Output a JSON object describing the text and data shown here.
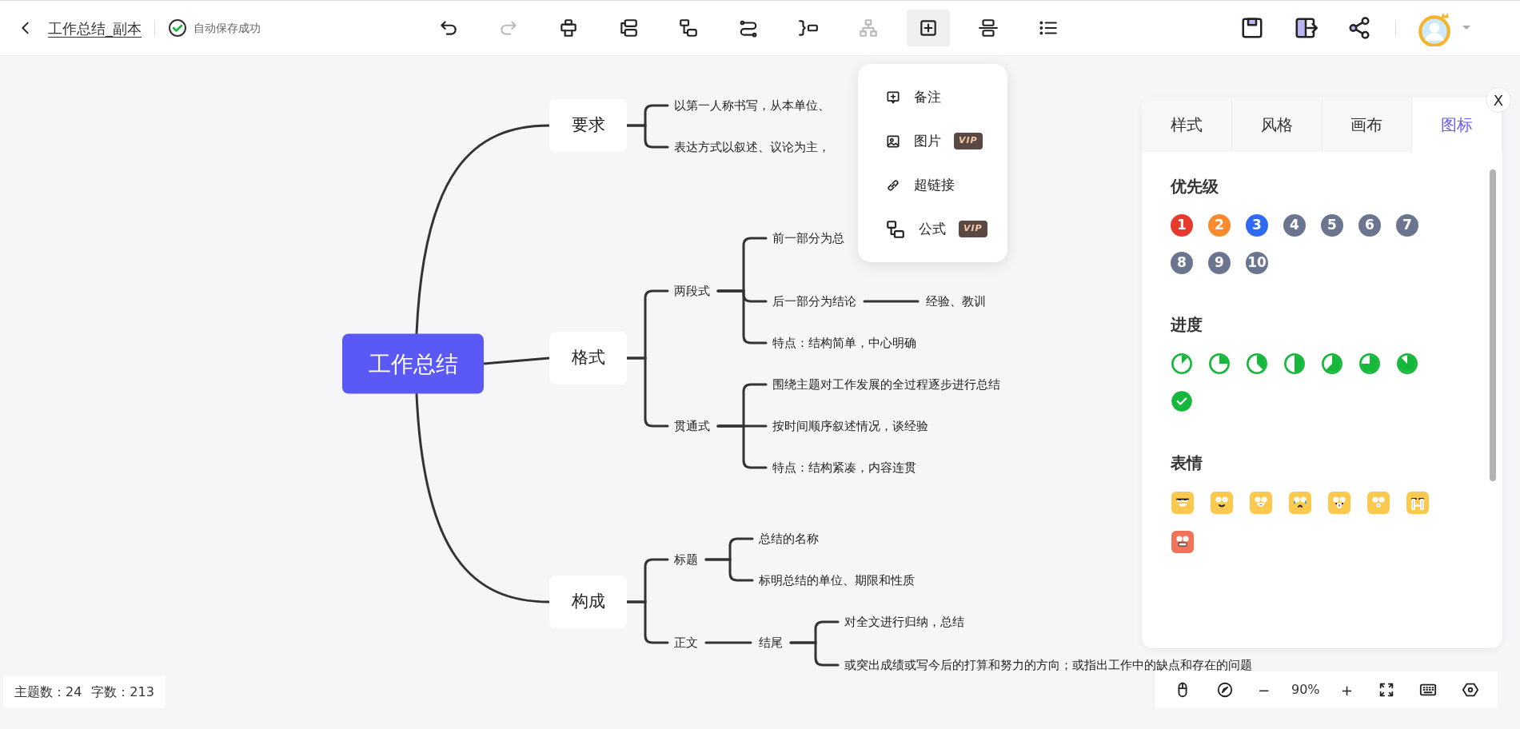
{
  "header": {
    "title": "工作总结_副本",
    "save_status": "自动保存成功"
  },
  "toolbar": [
    {
      "kind": "undo",
      "disabled": false,
      "selected": false
    },
    {
      "kind": "redo",
      "disabled": true,
      "selected": false
    },
    {
      "kind": "parent",
      "disabled": false,
      "selected": false
    },
    {
      "kind": "sibling",
      "disabled": false,
      "selected": false
    },
    {
      "kind": "child",
      "disabled": false,
      "selected": false
    },
    {
      "kind": "relation",
      "disabled": false,
      "selected": false
    },
    {
      "kind": "summary",
      "disabled": false,
      "selected": false
    },
    {
      "kind": "structure",
      "disabled": true,
      "selected": false
    },
    {
      "kind": "insert",
      "disabled": false,
      "selected": true
    },
    {
      "kind": "align",
      "disabled": false,
      "selected": false
    },
    {
      "kind": "outline",
      "disabled": false,
      "selected": false
    }
  ],
  "actions": [
    {
      "kind": "save"
    },
    {
      "kind": "export"
    },
    {
      "kind": "share"
    }
  ],
  "insert_menu": [
    {
      "kind": "note",
      "label": "备注"
    },
    {
      "kind": "image",
      "label": "图片",
      "badge": "VIP"
    },
    {
      "kind": "link",
      "label": "超链接"
    },
    {
      "kind": "formula",
      "label": "公式",
      "badge": "VIP"
    }
  ],
  "mind_map": {
    "root": {
      "label": "工作总结",
      "children": [
        {
          "label": "要求",
          "children": [
            {
              "label": "以第一人称书写，从本单位、"
            },
            {
              "label": "表达方式以叙述、议论为主，"
            }
          ]
        },
        {
          "label": "格式",
          "children": [
            {
              "label": "两段式",
              "children": [
                {
                  "label": "前一部分为总"
                },
                {
                  "label": "后一部分为结论",
                  "children": [
                    {
                      "label": "经验、教训"
                    }
                  ]
                },
                {
                  "label": "特点：结构简单，中心明确"
                }
              ]
            },
            {
              "label": "贯通式",
              "children": [
                {
                  "label": "围绕主题对工作发展的全过程逐步进行总结"
                },
                {
                  "label": "按时间顺序叙述情况，谈经验"
                },
                {
                  "label": "特点：结构紧凑，内容连贯"
                }
              ]
            }
          ]
        },
        {
          "label": "构成",
          "children": [
            {
              "label": "标题",
              "children": [
                {
                  "label": "总结的名称"
                },
                {
                  "label": "标明总结的单位、期限和性质"
                }
              ]
            },
            {
              "label": "正文",
              "children": [
                {
                  "label": "结尾",
                  "children": [
                    {
                      "label": "对全文进行归纳，总结"
                    },
                    {
                      "label": "或突出成绩或写今后的打算和努力的方向；或指出工作中的缺点和存在的问题"
                    }
                  ]
                }
              ]
            }
          ]
        }
      ]
    }
  },
  "panel": {
    "close": "X",
    "tabs": [
      {
        "label": "样式",
        "selected": false
      },
      {
        "label": "风格",
        "selected": false
      },
      {
        "label": "画布",
        "selected": false
      },
      {
        "label": "图标",
        "selected": true
      }
    ],
    "sections": [
      {
        "kind": "priority",
        "title": "优先级",
        "items": [
          {
            "text": "1",
            "color": "#e8392f"
          },
          {
            "text": "2",
            "color": "#f98b2b"
          },
          {
            "text": "3",
            "color": "#2f6af5"
          },
          {
            "text": "4",
            "color": "#6b7590"
          },
          {
            "text": "5",
            "color": "#6b7590"
          },
          {
            "text": "6",
            "color": "#6b7590"
          },
          {
            "text": "7",
            "color": "#6b7590"
          },
          {
            "text": "8",
            "color": "#6b7590"
          },
          {
            "text": "9",
            "color": "#6b7590"
          },
          {
            "text": "10",
            "color": "#6b7590"
          }
        ]
      },
      {
        "kind": "progress",
        "title": "进度",
        "items": [
          {
            "kind": "one-eighth"
          },
          {
            "kind": "quarter"
          },
          {
            "kind": "three-eighths"
          },
          {
            "kind": "half"
          },
          {
            "kind": "five-eighths"
          },
          {
            "kind": "three-quarters"
          },
          {
            "kind": "seven-eighths"
          },
          {
            "kind": "done"
          }
        ]
      },
      {
        "kind": "emoji",
        "title": "表情",
        "items": [
          {
            "kind": "cool"
          },
          {
            "kind": "smile"
          },
          {
            "kind": "happy"
          },
          {
            "kind": "sad"
          },
          {
            "kind": "tongue"
          },
          {
            "kind": "surprised"
          },
          {
            "kind": "cry"
          },
          {
            "kind": "angry"
          }
        ]
      }
    ]
  },
  "stats": [
    "主题数：24",
    "字数：213"
  ],
  "zoom_bar": {
    "zoom_out": "−",
    "zoom": "90%",
    "zoom_in": "+"
  }
}
